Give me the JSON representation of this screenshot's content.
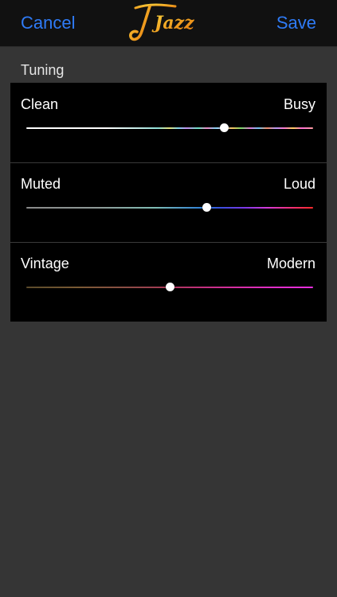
{
  "nav": {
    "cancel_label": "Cancel",
    "title": "Jazz",
    "save_label": "Save",
    "accent_color": "#2f7bf6",
    "logo_gradient": [
      "#f7d23e",
      "#f0a020",
      "#e57a10"
    ]
  },
  "section": {
    "title": "Tuning"
  },
  "sliders": [
    {
      "left_label": "Clean",
      "right_label": "Busy",
      "value": 0.69,
      "track": "linear-gradient(to right, #ffffff 0%, #ffffff 28%, #bde8e4 40%, #8de0d8 46%, #e9e27a 50%, #7fd9f0 53%, #c88ff0 56%, #6ae6c5 60%, #f08ac8 63%, #84d1f0 66%, #d7d7ff 68%, #f3c35c 72%, #7ad96b 75%, #e57ad8 78%, #6fc7f5 81%, #f38f6a 84%, #b59bf5 87%, #ff7ad0 90%, #ffd25c 93%, #ff6fd6 96%, #ff9f9f 100%)"
    },
    {
      "left_label": "Muted",
      "right_label": "Loud",
      "value": 0.63,
      "track": "linear-gradient(to right, #8a8a8a 0%, #8f9a98 25%, #7fbdb4 45%, #2a7dd8 62%, #3b4fe0 68%, #7a38e8 76%, #d43bd9 84%, #f0307a 92%, #ff2a2a 100%)"
    },
    {
      "left_label": "Vintage",
      "right_label": "Modern",
      "value": 0.5,
      "track": "linear-gradient(to right, #5a4a2a 0%, #7a5a34 18%, #8a4e44 34%, #a53a55 48%, #c0307a 60%, #d42ea0 72%, #e02ec8 86%, #e82ee0 100%)"
    }
  ]
}
